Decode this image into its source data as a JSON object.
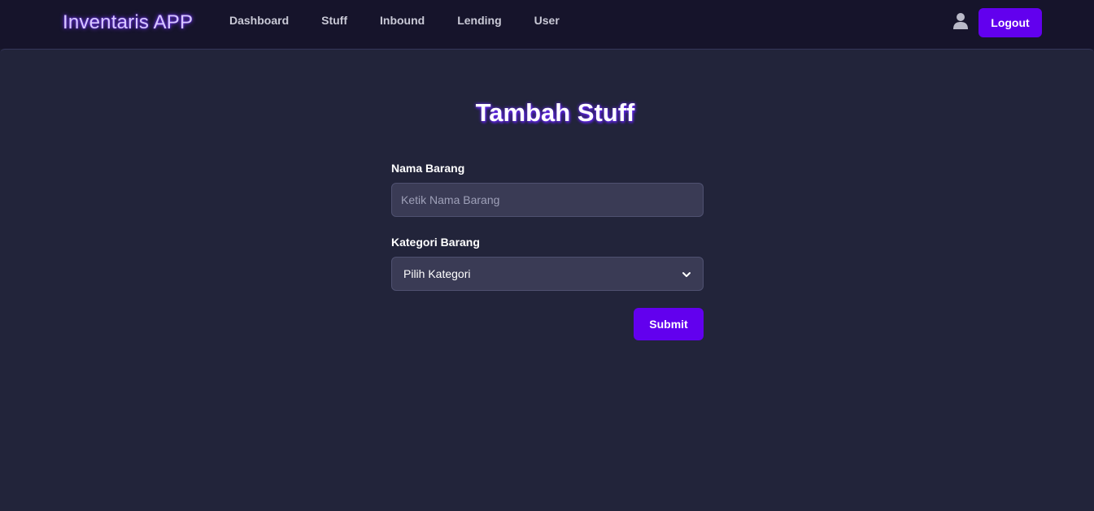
{
  "navbar": {
    "brand": "Inventaris APP",
    "links": [
      {
        "label": "Dashboard"
      },
      {
        "label": "Stuff"
      },
      {
        "label": "Inbound"
      },
      {
        "label": "Lending"
      },
      {
        "label": "User"
      }
    ],
    "user_icon": "user-icon",
    "logout_label": "Logout"
  },
  "page": {
    "title": "Tambah Stuff"
  },
  "form": {
    "name_label": "Nama Barang",
    "name_placeholder": "Ketik Nama Barang",
    "name_value": "",
    "category_label": "Kategori Barang",
    "category_selected": "Pilih Kategori",
    "submit_label": "Submit"
  },
  "colors": {
    "accent": "#6200ee",
    "navbar_bg": "#16142b",
    "main_bg": "#22243a",
    "input_bg": "#3a3b55"
  }
}
